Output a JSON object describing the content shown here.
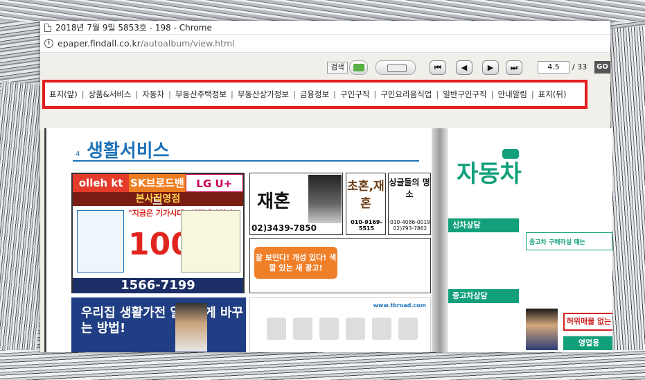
{
  "window": {
    "title": "2018년 7월 9일 5853호 - 198 - Chrome",
    "url_host": "epaper.findall.co.kr",
    "url_path": "/autoalbum/view.html"
  },
  "toolbar": {
    "search_label": "검색",
    "nav": {
      "first": "⏮",
      "prev": "◀",
      "next": "▶",
      "last": "⏭"
    },
    "page_current": "4.5",
    "page_total": "/ 33",
    "go_label": "GO"
  },
  "categories": [
    "표지(앞)",
    "상품&서비스",
    "자동차",
    "부동산주택정보",
    "부동산상가정보",
    "금융정보",
    "구인구직",
    "구인요리음식업",
    "일반구인구직",
    "안내알림",
    "표지(뒤)"
  ],
  "colors": {
    "accent_red": "#e41d1d",
    "lifestyle_blue": "#1e72b8",
    "auto_green": "#11a07a"
  },
  "left_page": {
    "number": "4",
    "heading": "생활서비스",
    "brands": [
      "olleh kt",
      "SK브로드밴드",
      "LG U+"
    ],
    "hq_label": "본사직영점",
    "kt_line": "\"지금은 기가시대\" 인터넷가입시",
    "kt_big": "100",
    "kt_phone": "1566-7199",
    "wedding_name": "재혼",
    "wedding_phone": "02)3439-7850",
    "chohon_title": "초혼,재혼",
    "chohon_phone": "010-9169-5515",
    "single_title": "싱글들의 명소",
    "single_phone": "010-4086-0019",
    "single_phone2": "02)793-7862",
    "mid_slogan": "잘 보인다! 개성 있다! 색깔 있는 새 광고!",
    "bottom_txt": "우리집 생활가전 알뜰하게 바꾸는 방법!",
    "bottom_url": "www.tbroad.com"
  },
  "right_page": {
    "heading": "자동차",
    "section1": "신차상담",
    "section2": "중고차상담",
    "banner": "중고차 구매하실 때는",
    "badge_red": "허위매물 없는",
    "badge_green": "영업용"
  }
}
